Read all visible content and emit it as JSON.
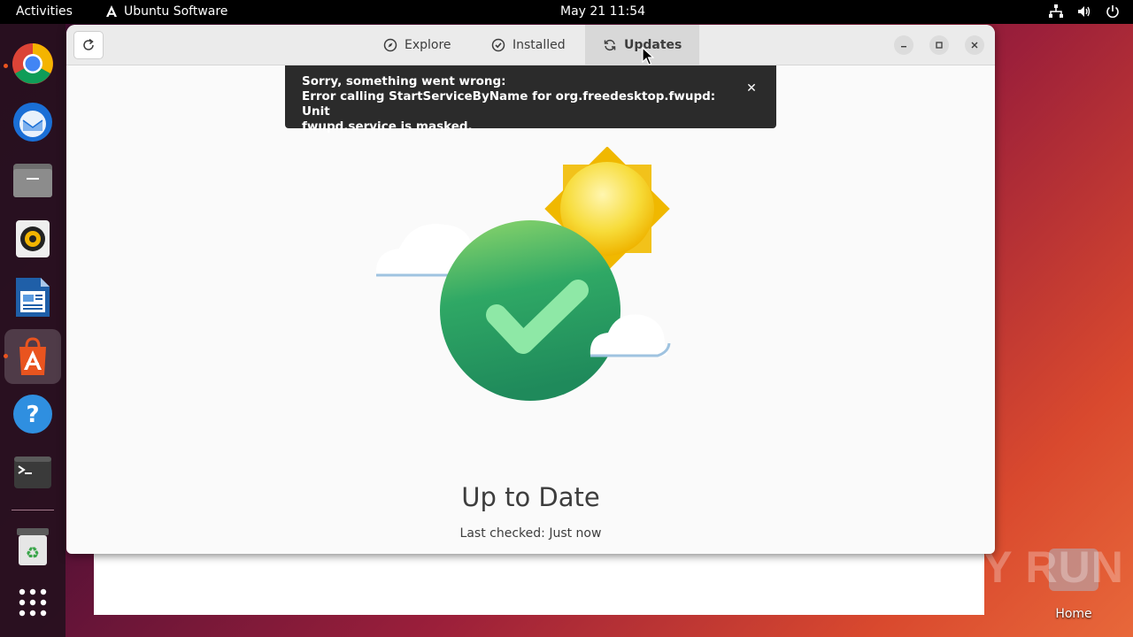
{
  "topbar": {
    "activities": "Activities",
    "app_name": "Ubuntu Software",
    "clock": "May 21  11:54",
    "tray_icons": [
      "network-icon",
      "volume-icon",
      "power-icon"
    ]
  },
  "dock": {
    "items": [
      {
        "name": "chrome",
        "icon": "chrome-icon",
        "running": true
      },
      {
        "name": "thunderbird",
        "icon": "thunderbird-icon",
        "running": false
      },
      {
        "name": "files",
        "icon": "files-icon",
        "running": false
      },
      {
        "name": "rhythmbox",
        "icon": "rhythmbox-icon",
        "running": false
      },
      {
        "name": "libreoffice-writer",
        "icon": "writer-icon",
        "running": false
      },
      {
        "name": "ubuntu-software",
        "icon": "software-icon",
        "running": true,
        "active": true
      },
      {
        "name": "help",
        "icon": "help-icon",
        "running": false
      },
      {
        "name": "terminal",
        "icon": "terminal-icon",
        "running": false
      },
      {
        "name": "trash",
        "icon": "trash-icon",
        "running": false
      },
      {
        "name": "show-apps",
        "icon": "app-grid-icon",
        "running": false
      }
    ]
  },
  "window": {
    "tabs": [
      {
        "label": "Explore",
        "icon": "compass-icon",
        "selected": false
      },
      {
        "label": "Installed",
        "icon": "check-circle-icon",
        "selected": false
      },
      {
        "label": "Updates",
        "icon": "sync-icon",
        "selected": true
      }
    ],
    "controls": [
      "minimize",
      "maximize",
      "close"
    ]
  },
  "toast": {
    "line1": "Sorry, something went wrong:",
    "line2": "Error calling StartServiceByName for org.freedesktop.fwupd: Unit",
    "line3": "fwupd.service is masked.",
    "close_glyph": "✕"
  },
  "status": {
    "title": "Up to Date",
    "subtitle": "Last checked: Just now"
  },
  "desktop": {
    "home_label": "Home",
    "watermark": "ANY RUN"
  },
  "colors": {
    "accent_orange": "#e9541f",
    "check_green": "#2fa865",
    "sun_yellow": "#f5c518"
  }
}
